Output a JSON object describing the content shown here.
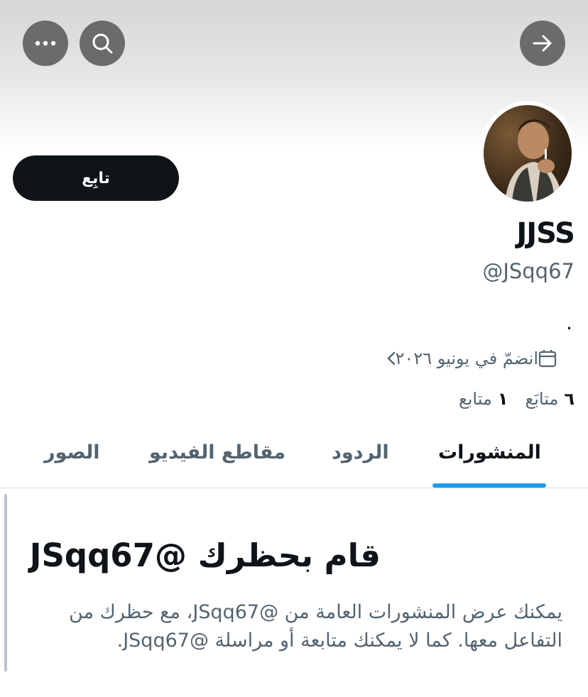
{
  "header": {
    "more_icon": "more-horizontal-icon",
    "search_icon": "search-icon",
    "back_icon": "arrow-right-icon"
  },
  "profile": {
    "follow_label": "تابِع",
    "display_name": "JJSS",
    "handle": "@JSqq67",
    "bio": ".",
    "joined_text": "انضمّ في يونيو ٢٠٢٦",
    "following_count": "٦",
    "following_label": "متابَع",
    "followers_count": "١",
    "followers_label": "متابع"
  },
  "tabs": [
    {
      "label": "المنشورات",
      "active": true
    },
    {
      "label": "الردود",
      "active": false
    },
    {
      "label": "مقاطع الفيديو",
      "active": false
    },
    {
      "label": "الصور",
      "active": false
    }
  ],
  "blocked": {
    "title": "قام بحظرك @JSqq67",
    "message": "يمكنك عرض المنشورات العامة من @JSqq67، مع حظرك من التفاعل معها. كما لا يمكنك متابعة أو مراسلة @JSqq67."
  },
  "colors": {
    "accent": "#1d9bf0",
    "text_primary": "#0f1419",
    "text_secondary": "#536471",
    "button_dark": "#0f1419"
  }
}
